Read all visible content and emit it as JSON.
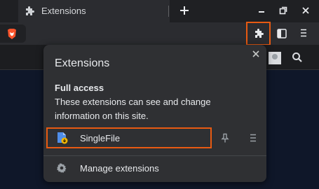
{
  "tab": {
    "title": "Extensions",
    "icon": "puzzle-icon"
  },
  "toolbar": {
    "brave_icon": "brave-lion-icon",
    "extensions_icon": "puzzle-icon",
    "sidebar_icon": "sidebar-icon",
    "menu_icon": "hamburger-menu-icon"
  },
  "popup": {
    "title": "Extensions",
    "section_heading": "Full access",
    "section_description": "These extensions can see and change information on this site.",
    "extensions": [
      {
        "name": "SingleFile",
        "icon": "singlefile-icon"
      }
    ],
    "manage_label": "Manage extensions"
  },
  "colors": {
    "highlight": "#e85a12",
    "popup_bg": "#2f3033",
    "toolbar_bg": "#2b2c30",
    "page_bg": "#0f1729",
    "brave_orange": "#fb542b"
  }
}
